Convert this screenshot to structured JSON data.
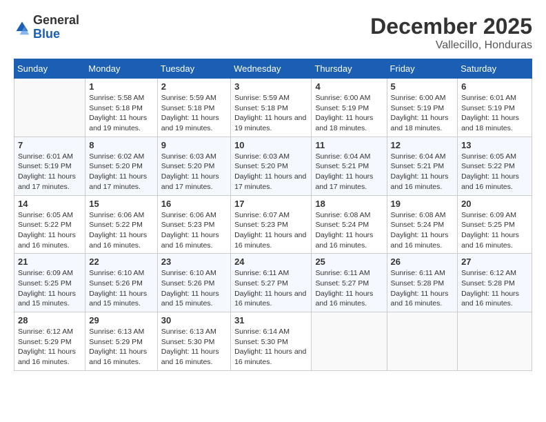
{
  "header": {
    "logo_general": "General",
    "logo_blue": "Blue",
    "month": "December 2025",
    "location": "Vallecillo, Honduras"
  },
  "columns": [
    "Sunday",
    "Monday",
    "Tuesday",
    "Wednesday",
    "Thursday",
    "Friday",
    "Saturday"
  ],
  "weeks": [
    [
      {
        "day": "",
        "sunrise": "",
        "sunset": "",
        "daylight": ""
      },
      {
        "day": "1",
        "sunrise": "Sunrise: 5:58 AM",
        "sunset": "Sunset: 5:18 PM",
        "daylight": "Daylight: 11 hours and 19 minutes."
      },
      {
        "day": "2",
        "sunrise": "Sunrise: 5:59 AM",
        "sunset": "Sunset: 5:18 PM",
        "daylight": "Daylight: 11 hours and 19 minutes."
      },
      {
        "day": "3",
        "sunrise": "Sunrise: 5:59 AM",
        "sunset": "Sunset: 5:18 PM",
        "daylight": "Daylight: 11 hours and 19 minutes."
      },
      {
        "day": "4",
        "sunrise": "Sunrise: 6:00 AM",
        "sunset": "Sunset: 5:19 PM",
        "daylight": "Daylight: 11 hours and 18 minutes."
      },
      {
        "day": "5",
        "sunrise": "Sunrise: 6:00 AM",
        "sunset": "Sunset: 5:19 PM",
        "daylight": "Daylight: 11 hours and 18 minutes."
      },
      {
        "day": "6",
        "sunrise": "Sunrise: 6:01 AM",
        "sunset": "Sunset: 5:19 PM",
        "daylight": "Daylight: 11 hours and 18 minutes."
      }
    ],
    [
      {
        "day": "7",
        "sunrise": "Sunrise: 6:01 AM",
        "sunset": "Sunset: 5:19 PM",
        "daylight": "Daylight: 11 hours and 17 minutes."
      },
      {
        "day": "8",
        "sunrise": "Sunrise: 6:02 AM",
        "sunset": "Sunset: 5:20 PM",
        "daylight": "Daylight: 11 hours and 17 minutes."
      },
      {
        "day": "9",
        "sunrise": "Sunrise: 6:03 AM",
        "sunset": "Sunset: 5:20 PM",
        "daylight": "Daylight: 11 hours and 17 minutes."
      },
      {
        "day": "10",
        "sunrise": "Sunrise: 6:03 AM",
        "sunset": "Sunset: 5:20 PM",
        "daylight": "Daylight: 11 hours and 17 minutes."
      },
      {
        "day": "11",
        "sunrise": "Sunrise: 6:04 AM",
        "sunset": "Sunset: 5:21 PM",
        "daylight": "Daylight: 11 hours and 17 minutes."
      },
      {
        "day": "12",
        "sunrise": "Sunrise: 6:04 AM",
        "sunset": "Sunset: 5:21 PM",
        "daylight": "Daylight: 11 hours and 16 minutes."
      },
      {
        "day": "13",
        "sunrise": "Sunrise: 6:05 AM",
        "sunset": "Sunset: 5:22 PM",
        "daylight": "Daylight: 11 hours and 16 minutes."
      }
    ],
    [
      {
        "day": "14",
        "sunrise": "Sunrise: 6:05 AM",
        "sunset": "Sunset: 5:22 PM",
        "daylight": "Daylight: 11 hours and 16 minutes."
      },
      {
        "day": "15",
        "sunrise": "Sunrise: 6:06 AM",
        "sunset": "Sunset: 5:22 PM",
        "daylight": "Daylight: 11 hours and 16 minutes."
      },
      {
        "day": "16",
        "sunrise": "Sunrise: 6:06 AM",
        "sunset": "Sunset: 5:23 PM",
        "daylight": "Daylight: 11 hours and 16 minutes."
      },
      {
        "day": "17",
        "sunrise": "Sunrise: 6:07 AM",
        "sunset": "Sunset: 5:23 PM",
        "daylight": "Daylight: 11 hours and 16 minutes."
      },
      {
        "day": "18",
        "sunrise": "Sunrise: 6:08 AM",
        "sunset": "Sunset: 5:24 PM",
        "daylight": "Daylight: 11 hours and 16 minutes."
      },
      {
        "day": "19",
        "sunrise": "Sunrise: 6:08 AM",
        "sunset": "Sunset: 5:24 PM",
        "daylight": "Daylight: 11 hours and 16 minutes."
      },
      {
        "day": "20",
        "sunrise": "Sunrise: 6:09 AM",
        "sunset": "Sunset: 5:25 PM",
        "daylight": "Daylight: 11 hours and 16 minutes."
      }
    ],
    [
      {
        "day": "21",
        "sunrise": "Sunrise: 6:09 AM",
        "sunset": "Sunset: 5:25 PM",
        "daylight": "Daylight: 11 hours and 15 minutes."
      },
      {
        "day": "22",
        "sunrise": "Sunrise: 6:10 AM",
        "sunset": "Sunset: 5:26 PM",
        "daylight": "Daylight: 11 hours and 15 minutes."
      },
      {
        "day": "23",
        "sunrise": "Sunrise: 6:10 AM",
        "sunset": "Sunset: 5:26 PM",
        "daylight": "Daylight: 11 hours and 15 minutes."
      },
      {
        "day": "24",
        "sunrise": "Sunrise: 6:11 AM",
        "sunset": "Sunset: 5:27 PM",
        "daylight": "Daylight: 11 hours and 16 minutes."
      },
      {
        "day": "25",
        "sunrise": "Sunrise: 6:11 AM",
        "sunset": "Sunset: 5:27 PM",
        "daylight": "Daylight: 11 hours and 16 minutes."
      },
      {
        "day": "26",
        "sunrise": "Sunrise: 6:11 AM",
        "sunset": "Sunset: 5:28 PM",
        "daylight": "Daylight: 11 hours and 16 minutes."
      },
      {
        "day": "27",
        "sunrise": "Sunrise: 6:12 AM",
        "sunset": "Sunset: 5:28 PM",
        "daylight": "Daylight: 11 hours and 16 minutes."
      }
    ],
    [
      {
        "day": "28",
        "sunrise": "Sunrise: 6:12 AM",
        "sunset": "Sunset: 5:29 PM",
        "daylight": "Daylight: 11 hours and 16 minutes."
      },
      {
        "day": "29",
        "sunrise": "Sunrise: 6:13 AM",
        "sunset": "Sunset: 5:29 PM",
        "daylight": "Daylight: 11 hours and 16 minutes."
      },
      {
        "day": "30",
        "sunrise": "Sunrise: 6:13 AM",
        "sunset": "Sunset: 5:30 PM",
        "daylight": "Daylight: 11 hours and 16 minutes."
      },
      {
        "day": "31",
        "sunrise": "Sunrise: 6:14 AM",
        "sunset": "Sunset: 5:30 PM",
        "daylight": "Daylight: 11 hours and 16 minutes."
      },
      {
        "day": "",
        "sunrise": "",
        "sunset": "",
        "daylight": ""
      },
      {
        "day": "",
        "sunrise": "",
        "sunset": "",
        "daylight": ""
      },
      {
        "day": "",
        "sunrise": "",
        "sunset": "",
        "daylight": ""
      }
    ]
  ]
}
